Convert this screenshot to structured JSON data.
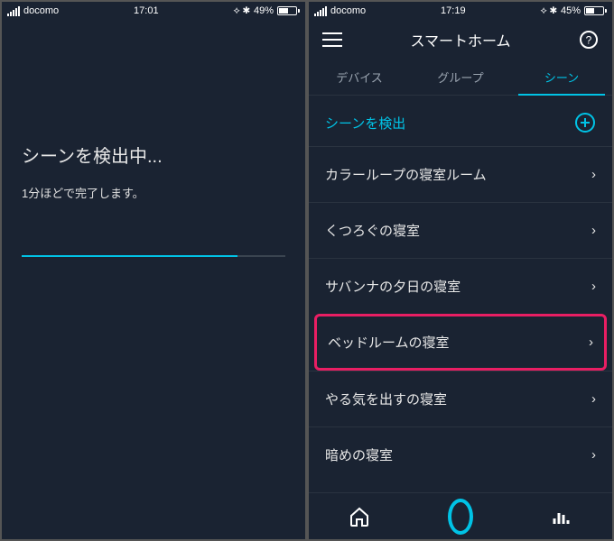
{
  "left": {
    "status": {
      "carrier": "docomo",
      "time": "17:01",
      "battery_pct": "49%",
      "battery_fill": 49
    },
    "title": "シーンを検出中...",
    "subtitle": "1分ほどで完了します。",
    "progress_pct": 82
  },
  "right": {
    "status": {
      "carrier": "docomo",
      "time": "17:19",
      "battery_pct": "45%",
      "battery_fill": 45
    },
    "nav_title": "スマートホーム",
    "tabs": {
      "devices": "デバイス",
      "groups": "グループ",
      "scenes": "シーン"
    },
    "section_label": "シーンを検出",
    "scenes": [
      "カラーループの寝室ルーム",
      "くつろぐの寝室",
      "サバンナの夕日の寝室",
      "ベッドルームの寝室",
      "やる気を出すの寝室",
      "暗めの寝室"
    ],
    "highlight_index": 3
  },
  "colors": {
    "accent": "#00c3e6",
    "highlight": "#e91e63",
    "bg": "#1a2332"
  }
}
